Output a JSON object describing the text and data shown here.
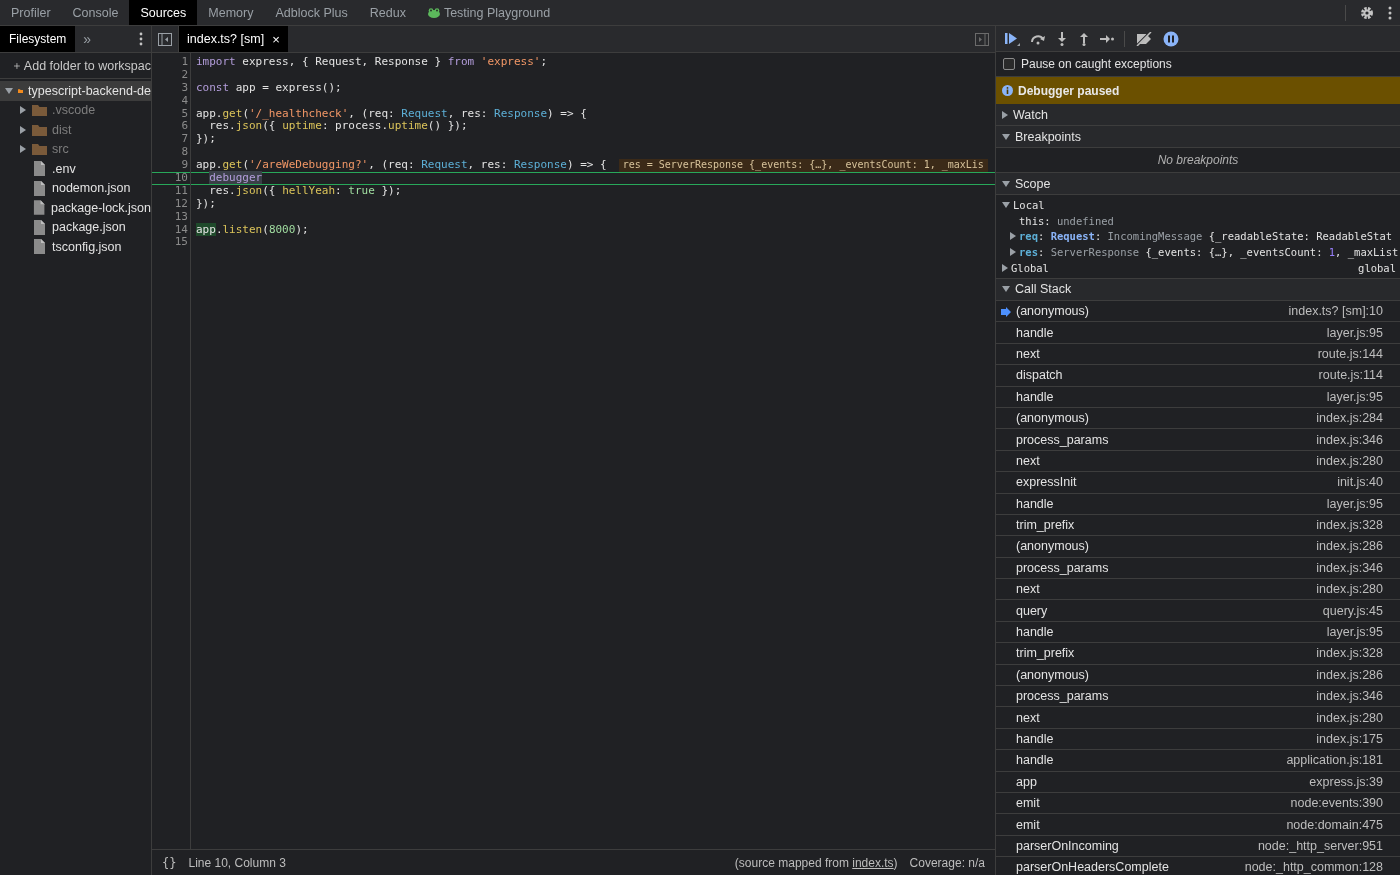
{
  "devtools_tabs": [
    {
      "label": "Profiler",
      "selected": false
    },
    {
      "label": "Console",
      "selected": false
    },
    {
      "label": "Sources",
      "selected": true
    },
    {
      "label": "Memory",
      "selected": false
    },
    {
      "label": "Adblock Plus",
      "selected": false
    },
    {
      "label": "Redux",
      "selected": false
    },
    {
      "label": "Testing Playground",
      "selected": false,
      "kind": "extension"
    }
  ],
  "navigator": {
    "tabs": [
      {
        "label": "Filesystem",
        "selected": true
      }
    ],
    "more_tabs": "»",
    "add_folder": "Add folder to workspac",
    "tree": [
      {
        "label": "typescript-backend-de",
        "kind": "folder",
        "expanded": true,
        "selected": true,
        "dimmed": false,
        "children": [
          {
            "label": ".vscode",
            "kind": "folder",
            "expanded": false,
            "selected": false,
            "dimmed": true
          },
          {
            "label": "dist",
            "kind": "folder",
            "expanded": false,
            "selected": false,
            "dimmed": true
          },
          {
            "label": "src",
            "kind": "folder",
            "expanded": false,
            "selected": false,
            "dimmed": true
          },
          {
            "label": ".env",
            "kind": "file",
            "selected": false,
            "dimmed": false
          },
          {
            "label": "nodemon.json",
            "kind": "file",
            "selected": false,
            "dimmed": false
          },
          {
            "label": "package-lock.json",
            "kind": "file",
            "selected": false,
            "dimmed": false
          },
          {
            "label": "package.json",
            "kind": "file",
            "selected": false,
            "dimmed": false
          },
          {
            "label": "tsconfig.json",
            "kind": "file",
            "selected": false,
            "dimmed": false
          }
        ]
      }
    ]
  },
  "editor": {
    "tabs": [
      {
        "label": "index.ts? [sm]",
        "selected": true,
        "close": "×"
      }
    ],
    "lines": [
      {
        "number": "1",
        "paused": false,
        "tokens": [
          {
            "kind": "kw",
            "text": "import"
          },
          {
            "kind": "plain",
            "text": " express, { Request, Response } "
          },
          {
            "kind": "kw",
            "text": "from"
          },
          {
            "kind": "str",
            "text": " 'express'"
          },
          {
            "kind": "plain",
            "text": ";"
          }
        ]
      },
      {
        "number": "2",
        "paused": false
      },
      {
        "number": "3",
        "paused": false,
        "tokens": [
          {
            "kind": "kw",
            "text": "const"
          },
          {
            "kind": "plain",
            "text": " app = express();"
          }
        ]
      },
      {
        "number": "4",
        "paused": false
      },
      {
        "number": "5",
        "paused": false,
        "tokens": [
          {
            "kind": "plain",
            "text": "app."
          },
          {
            "kind": "fn",
            "text": "get"
          },
          {
            "kind": "plain",
            "text": "("
          },
          {
            "kind": "str",
            "text": "'/_healthcheck'"
          },
          {
            "kind": "plain",
            "text": ", (req: "
          },
          {
            "kind": "type",
            "text": "Request"
          },
          {
            "kind": "plain",
            "text": ", res: "
          },
          {
            "kind": "type",
            "text": "Response"
          },
          {
            "kind": "plain",
            "text": ") => {"
          }
        ]
      },
      {
        "number": "6",
        "paused": false,
        "tokens": [
          {
            "kind": "plain",
            "text": "  res."
          },
          {
            "kind": "fn",
            "text": "json"
          },
          {
            "kind": "plain",
            "text": "({ "
          },
          {
            "kind": "fn",
            "text": "uptime"
          },
          {
            "kind": "plain",
            "text": ": process."
          },
          {
            "kind": "fn",
            "text": "uptime"
          },
          {
            "kind": "plain",
            "text": "() });"
          }
        ]
      },
      {
        "number": "7",
        "paused": false,
        "tokens": [
          {
            "kind": "plain",
            "text": "});"
          }
        ]
      },
      {
        "number": "8",
        "paused": false
      },
      {
        "number": "9",
        "paused": false,
        "inline_value": "res = ServerResponse {_events: {…}, _eventsCount: 1, _maxLis",
        "tokens": [
          {
            "kind": "plain",
            "text": "app."
          },
          {
            "kind": "fn",
            "text": "get"
          },
          {
            "kind": "plain",
            "text": "("
          },
          {
            "kind": "str",
            "text": "'/areWeDebugging?'"
          },
          {
            "kind": "plain",
            "text": ", (req: "
          },
          {
            "kind": "type",
            "text": "Request"
          },
          {
            "kind": "plain",
            "text": ", res: "
          },
          {
            "kind": "type",
            "text": "Response"
          },
          {
            "kind": "plain",
            "text": ") => {"
          }
        ]
      },
      {
        "number": "10",
        "paused": true,
        "indented": true,
        "tokens": [
          {
            "kind": "kw-mark",
            "text": "debugger"
          }
        ]
      },
      {
        "number": "11",
        "paused": false,
        "tokens": [
          {
            "kind": "plain",
            "text": "  res."
          },
          {
            "kind": "fn",
            "text": "json"
          },
          {
            "kind": "plain",
            "text": "({ "
          },
          {
            "kind": "fn",
            "text": "hellYeah"
          },
          {
            "kind": "plain",
            "text": ": "
          },
          {
            "kind": "lit",
            "text": "true"
          },
          {
            "kind": "plain",
            "text": " });"
          }
        ]
      },
      {
        "number": "12",
        "paused": false,
        "tokens": [
          {
            "kind": "plain",
            "text": "});"
          }
        ]
      },
      {
        "number": "13",
        "paused": false
      },
      {
        "number": "14",
        "paused": false,
        "tokens": [
          {
            "kind": "mark",
            "text": "app"
          },
          {
            "kind": "plain",
            "text": "."
          },
          {
            "kind": "fn",
            "text": "listen"
          },
          {
            "kind": "plain",
            "text": "("
          },
          {
            "kind": "lit",
            "text": "8000"
          },
          {
            "kind": "plain",
            "text": ");"
          }
        ]
      },
      {
        "number": "15",
        "paused": false
      }
    ],
    "status": {
      "format_button": "{}",
      "position": "Line 10, Column 3",
      "source_before": "(source mapped from ",
      "source_link": "index.ts",
      "source_after": ")",
      "coverage": "Coverage: n/a"
    }
  },
  "debugger": {
    "pause_on_caught": {
      "label": "Pause on caught exceptions",
      "checked": false
    },
    "banner": "Debugger paused",
    "watch": {
      "title": "Watch",
      "expanded": false
    },
    "breakpoints": {
      "title": "Breakpoints",
      "expanded": true,
      "empty_message": "No breakpoints"
    },
    "scope": {
      "title": "Scope",
      "expanded": true,
      "groups": [
        {
          "label": "Local",
          "expanded": true,
          "children": [
            {
              "expandable": false,
              "tokens": [
                {
                  "kind": "plain",
                  "text": "this"
                },
                {
                  "kind": "punct",
                  "text": ": "
                },
                {
                  "kind": "dim",
                  "text": "undefined"
                }
              ]
            },
            {
              "expandable": true,
              "expanded": false,
              "tokens": [
                {
                  "kind": "name",
                  "text": "req"
                },
                {
                  "kind": "punct",
                  "text": ": "
                },
                {
                  "kind": "type",
                  "text": "Request"
                },
                {
                  "kind": "punct",
                  "text": ": "
                },
                {
                  "kind": "dim",
                  "text": "IncomingMessage "
                },
                {
                  "kind": "plain",
                  "text": "{_readableState: ReadableStat"
                }
              ]
            },
            {
              "expandable": true,
              "expanded": false,
              "tokens": [
                {
                  "kind": "name",
                  "text": "res"
                },
                {
                  "kind": "punct",
                  "text": ": "
                },
                {
                  "kind": "dim",
                  "text": "ServerResponse "
                },
                {
                  "kind": "plain",
                  "text": "{_events: {…}, _eventsCount: "
                },
                {
                  "kind": "num",
                  "text": "1"
                },
                {
                  "kind": "plain",
                  "text": ", _maxList"
                }
              ]
            }
          ]
        },
        {
          "label": "Global",
          "expanded": false,
          "value": "global"
        }
      ]
    },
    "call_stack": {
      "title": "Call Stack",
      "expanded": true,
      "frames": [
        {
          "function": "(anonymous)",
          "location": "index.ts? [sm]:10",
          "current": true
        },
        {
          "function": "handle",
          "location": "layer.js:95",
          "current": false
        },
        {
          "function": "next",
          "location": "route.js:144",
          "current": false
        },
        {
          "function": "dispatch",
          "location": "route.js:114",
          "current": false
        },
        {
          "function": "handle",
          "location": "layer.js:95",
          "current": false
        },
        {
          "function": "(anonymous)",
          "location": "index.js:284",
          "current": false
        },
        {
          "function": "process_params",
          "location": "index.js:346",
          "current": false
        },
        {
          "function": "next",
          "location": "index.js:280",
          "current": false
        },
        {
          "function": "expressInit",
          "location": "init.js:40",
          "current": false
        },
        {
          "function": "handle",
          "location": "layer.js:95",
          "current": false
        },
        {
          "function": "trim_prefix",
          "location": "index.js:328",
          "current": false
        },
        {
          "function": "(anonymous)",
          "location": "index.js:286",
          "current": false
        },
        {
          "function": "process_params",
          "location": "index.js:346",
          "current": false
        },
        {
          "function": "next",
          "location": "index.js:280",
          "current": false
        },
        {
          "function": "query",
          "location": "query.js:45",
          "current": false
        },
        {
          "function": "handle",
          "location": "layer.js:95",
          "current": false
        },
        {
          "function": "trim_prefix",
          "location": "index.js:328",
          "current": false
        },
        {
          "function": "(anonymous)",
          "location": "index.js:286",
          "current": false
        },
        {
          "function": "process_params",
          "location": "index.js:346",
          "current": false
        },
        {
          "function": "next",
          "location": "index.js:280",
          "current": false
        },
        {
          "function": "handle",
          "location": "index.js:175",
          "current": false
        },
        {
          "function": "handle",
          "location": "application.js:181",
          "current": false
        },
        {
          "function": "app",
          "location": "express.js:39",
          "current": false
        },
        {
          "function": "emit",
          "location": "node:events:390",
          "current": false
        },
        {
          "function": "emit",
          "location": "node:domain:475",
          "current": false
        },
        {
          "function": "parserOnIncoming",
          "location": "node:_http_server:951",
          "current": false
        },
        {
          "function": "parserOnHeadersComplete",
          "location": "node:_http_common:128",
          "current": false
        }
      ]
    }
  }
}
